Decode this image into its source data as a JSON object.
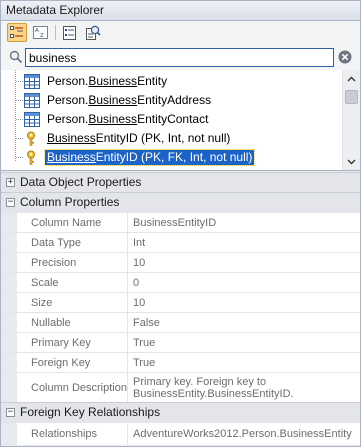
{
  "window": {
    "title": "Metadata Explorer"
  },
  "toolbar": {
    "buttons": [
      {
        "icon": "categorized-view-icon",
        "active": true
      },
      {
        "icon": "sort-alphabetical-icon",
        "active": false
      },
      {
        "icon": "property-pages-icon",
        "active": false
      },
      {
        "icon": "search-settings-icon",
        "active": false
      }
    ]
  },
  "search": {
    "value": "business",
    "placeholder": ""
  },
  "tree": {
    "items": [
      {
        "prefix": "Person.",
        "match": "Business",
        "suffix": "Entity",
        "icon": "table-icon",
        "selected": false
      },
      {
        "prefix": "Person.",
        "match": "Business",
        "suffix": "EntityAddress",
        "icon": "table-icon",
        "selected": false
      },
      {
        "prefix": "Person.",
        "match": "Business",
        "suffix": "EntityContact",
        "icon": "table-icon",
        "selected": false
      },
      {
        "prefix": "",
        "match": "Business",
        "suffix": "EntityID (PK, Int, not null)",
        "icon": "key-icon",
        "selected": false
      },
      {
        "prefix": "",
        "match": "Business",
        "suffix": "EntityID (PK, FK, Int, not null)",
        "icon": "key-icon",
        "selected": true
      }
    ]
  },
  "properties": {
    "data_object_category": "Data Object Properties",
    "column_category": "Column Properties",
    "fk_category": "Foreign Key Relationships",
    "column_rows": [
      {
        "name": "Column Name",
        "value": "BusinessEntityID"
      },
      {
        "name": "Data Type",
        "value": "Int"
      },
      {
        "name": "Precision",
        "value": "10"
      },
      {
        "name": "Scale",
        "value": "0"
      },
      {
        "name": "Size",
        "value": "10"
      },
      {
        "name": "Nullable",
        "value": "False"
      },
      {
        "name": "Primary Key",
        "value": "True"
      },
      {
        "name": "Foreign Key",
        "value": "True"
      },
      {
        "name": "Column Description",
        "value": "Primary key. Foreign key to BusinessEntity.BusinessEntityID."
      }
    ],
    "fk_rows": [
      {
        "name": "Relationships",
        "value": "AdventureWorks2012.Person.BusinessEntity"
      }
    ]
  }
}
